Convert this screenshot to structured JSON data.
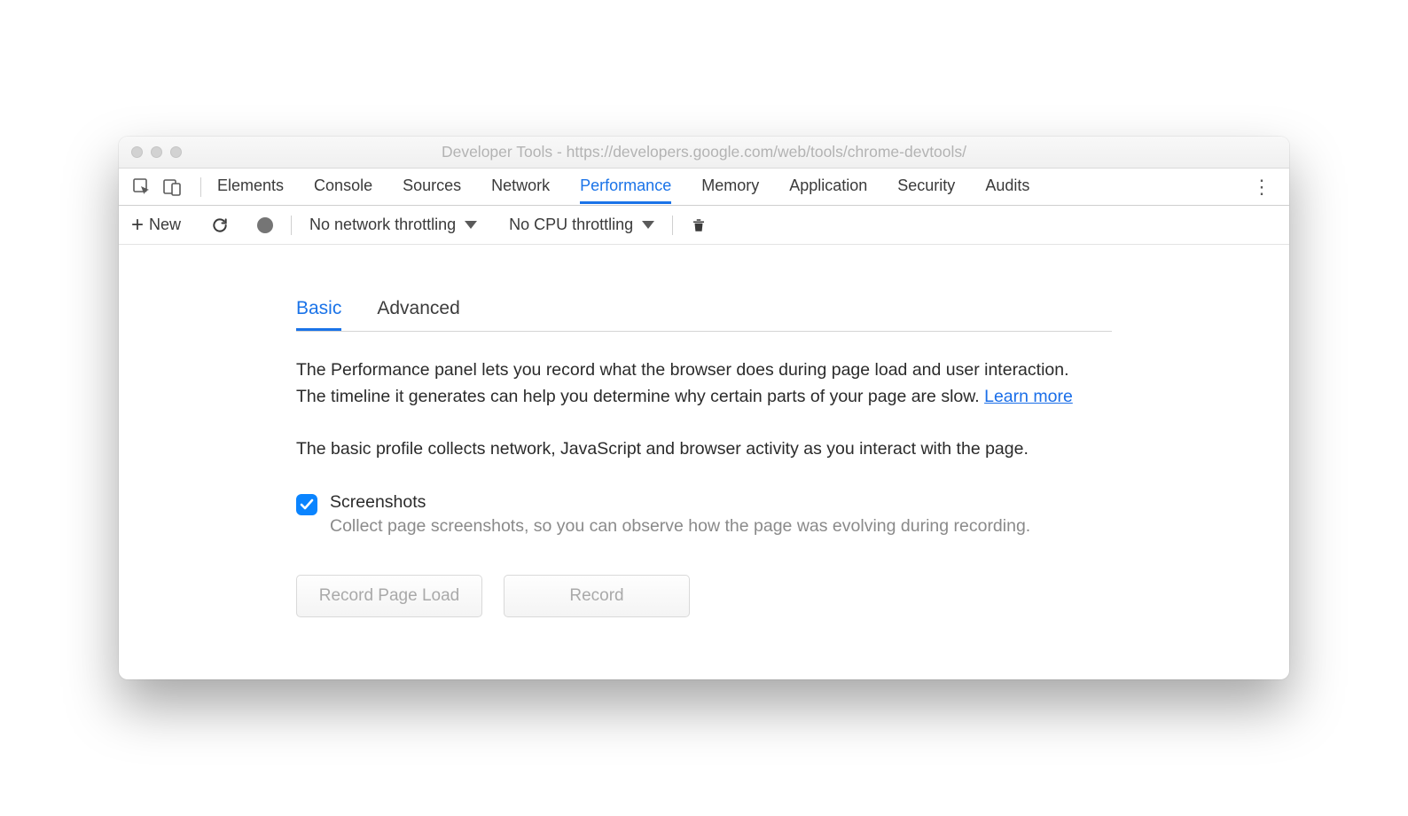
{
  "window": {
    "title": "Developer Tools - https://developers.google.com/web/tools/chrome-devtools/"
  },
  "tabs": [
    "Elements",
    "Console",
    "Sources",
    "Network",
    "Performance",
    "Memory",
    "Application",
    "Security",
    "Audits"
  ],
  "active_tab": "Performance",
  "toolbar": {
    "new_label": "New",
    "network_throttle": "No network throttling",
    "cpu_throttle": "No CPU throttling"
  },
  "subtabs": {
    "basic": "Basic",
    "advanced": "Advanced",
    "active": "Basic"
  },
  "intro": {
    "text": "The Performance panel lets you record what the browser does during page load and user interaction. The timeline it generates can help you determine why certain parts of your page are slow.  ",
    "learn_more": "Learn more"
  },
  "basic_desc": "The basic profile collects network, JavaScript and browser activity as you interact with the page.",
  "option": {
    "label": "Screenshots",
    "description": "Collect page screenshots, so you can observe how the page was evolving during recording.",
    "checked": true
  },
  "buttons": {
    "record_page_load": "Record Page Load",
    "record": "Record"
  }
}
